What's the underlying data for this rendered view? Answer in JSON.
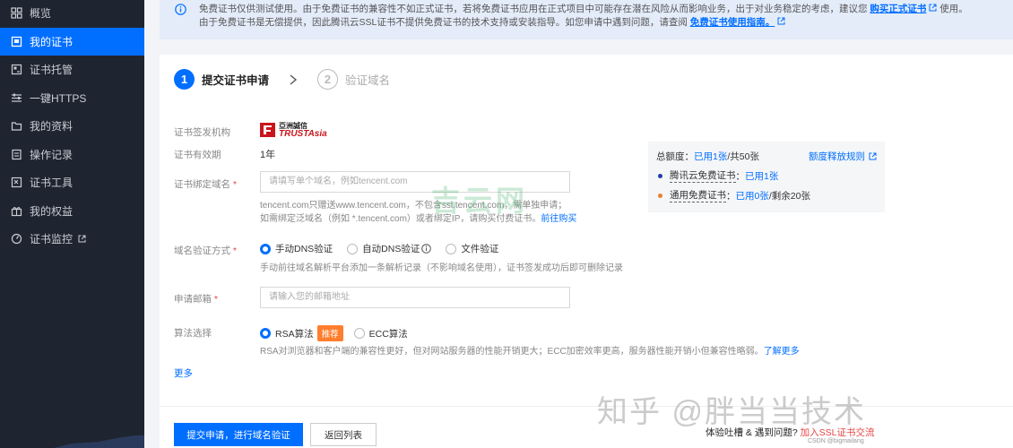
{
  "sidebar": {
    "items": [
      {
        "label": "概览",
        "icon": "grid-icon"
      },
      {
        "label": "我的证书",
        "icon": "certificate-icon",
        "active": true
      },
      {
        "label": "证书托管",
        "icon": "hosting-icon"
      },
      {
        "label": "一键HTTPS",
        "icon": "sliders-icon"
      },
      {
        "label": "我的资料",
        "icon": "folder-icon"
      },
      {
        "label": "操作记录",
        "icon": "record-icon"
      },
      {
        "label": "证书工具",
        "icon": "tool-icon"
      },
      {
        "label": "我的权益",
        "icon": "gift-icon"
      },
      {
        "label": "证书监控",
        "icon": "monitor-icon",
        "external": true
      }
    ]
  },
  "notice": {
    "line1_pre": "免费证书仅供测试使用。由于免费证书的兼容性不如正式证书，若将免费证书应用在正式项目中可能存在潜在风险从而影响业务，出于对业务稳定的考虑，建议您",
    "line1_link": "购买正式证书",
    "line1_post": "使用。",
    "line2_pre": "由于免费证书是无偿提供，因此腾讯云SSL证书不提供免费证书的技术支持或安装指导。如您申请中遇到问题，请查阅",
    "line2_link": "免费证书使用指南。"
  },
  "steps": [
    {
      "num": "1",
      "label": "提交证书申请"
    },
    {
      "num": "2",
      "label": "验证域名"
    }
  ],
  "form": {
    "issuer_label": "证书签发机构",
    "issuer_logo_cn": "亞洲誠信",
    "issuer_logo_en": "TRUSTAsia",
    "validity_label": "证书有效期",
    "validity_value": "1年",
    "domain_label": "证书绑定域名",
    "domain_placeholder": "请填写单个域名，例如tencent.com",
    "domain_hint1": "tencent.com只赠送www.tencent.com，不包含ssl.tencent.com，需单独申请；",
    "domain_hint2_pre": "如需绑定泛域名（例如 *.tencent.com）或者绑定IP，请购买付费证书。",
    "domain_hint2_link": "前往购买",
    "verify_label": "域名验证方式",
    "verify_options": [
      "手动DNS验证",
      "自动DNS验证",
      "文件验证"
    ],
    "verify_hint": "手动前往域名解析平台添加一条解析记录（不影响域名使用），证书签发成功后即可删除记录",
    "email_label": "申请邮箱",
    "email_placeholder": "请输入您的邮箱地址",
    "algo_label": "算法选择",
    "algo_options": [
      "RSA算法",
      "ECC算法"
    ],
    "algo_tag": "推荐",
    "algo_hint_pre": "RSA对浏览器和客户端的兼容性更好，但对网站服务器的性能开销更大；ECC加密效率更高，服务器性能开销小但兼容性略弱。",
    "algo_hint_link": "了解更多",
    "more": "更多"
  },
  "quota": {
    "total_label": "总额度：",
    "total_used": "已用1张",
    "total_rest": "/共50张",
    "rule_link": "额度释放规则",
    "row1_label": "腾讯云免费证书",
    "row1_value": "已用1张",
    "row2_label": "通用免费证书",
    "row2_value": "已用0张",
    "row2_rest": "/剩余20张",
    "colors": {
      "dot_blue": "#1f3fa8",
      "dot_orange": "#e8812c"
    }
  },
  "buttons": {
    "submit": "提交申请，进行域名验证",
    "back": "返回列表"
  },
  "watermarks": {
    "center": "吉云网",
    "zhihu": "知乎 @胖当当技术",
    "csdn": "CSDN @bigmailang"
  },
  "feedback": {
    "pre": "体验吐槽 & 遇到问题?",
    "link": "加入SSL证书交流"
  }
}
